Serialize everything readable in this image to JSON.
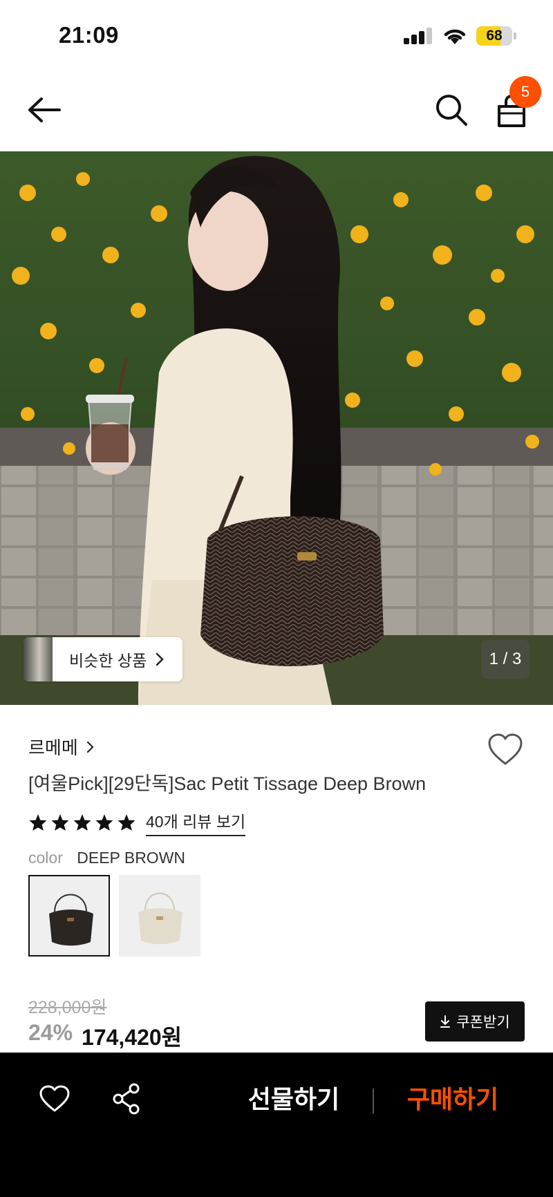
{
  "status_bar": {
    "time": "21:09",
    "battery": "68",
    "icons": [
      "signal-icon",
      "wifi-icon",
      "battery-icon"
    ]
  },
  "nav": {
    "icons": [
      "back-arrow-icon",
      "search-icon",
      "shopping-bag-icon"
    ],
    "cart_count": "5"
  },
  "gallery": {
    "similar_label": "비슷한 상품",
    "page_indicator": "1 / 3",
    "current_page": 1,
    "total_pages": 3
  },
  "product": {
    "brand": "르메메",
    "title": "[여울Pick][29단독]Sac Petit Tissage Deep Brown",
    "rating_stars": 5,
    "review_link": "40개 리뷰 보기",
    "color_label": "color",
    "color_value": "DEEP BROWN",
    "swatches": [
      "deep-brown",
      "ivory"
    ],
    "original_price": "228,000원",
    "discount": "24%",
    "sale_price": "174,420원",
    "coupon_label": "쿠폰받기"
  },
  "bottom_bar": {
    "gift_label": "선물하기",
    "buy_label": "구매하기",
    "icons": [
      "heart-icon",
      "share-icon"
    ]
  },
  "colors": {
    "accent": "#ff4f00",
    "battery": "#f7d31a",
    "bottom_bar": "#000000"
  }
}
